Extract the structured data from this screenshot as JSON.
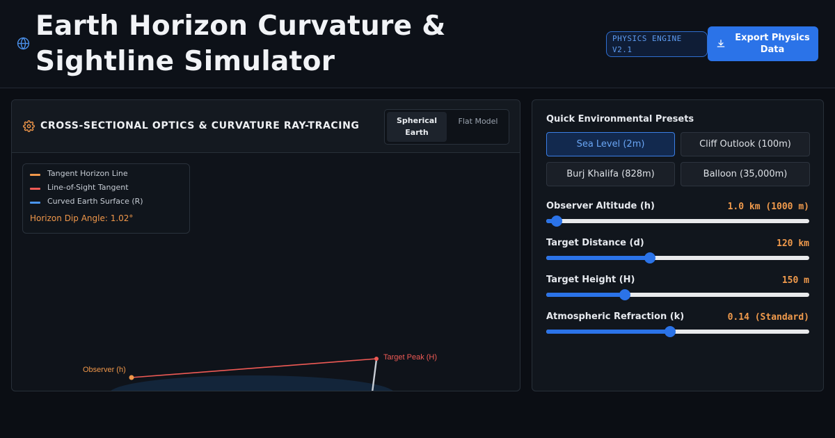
{
  "header": {
    "title": "Earth Horizon Curvature & Sightline Simulator",
    "badge": "PHYSICS ENGINE V2.1",
    "export_label": "Export Physics Data"
  },
  "viz": {
    "title": "CROSS-SECTIONAL OPTICS & CURVATURE RAY-TRACING",
    "model_options": [
      "Spherical Earth",
      "Flat Model"
    ],
    "selected_model": "Spherical Earth",
    "legend": [
      {
        "label": "Tangent Horizon Line",
        "color": "#f0974a"
      },
      {
        "label": "Line-of-Sight Tangent",
        "color": "#ef5a55"
      },
      {
        "label": "Curved Earth Surface (R)",
        "color": "#4a95f0"
      }
    ],
    "dip_label": "Horizon Dip Angle: 1.02°",
    "observer_label": "Observer (h)",
    "target_label": "Target Peak (H)"
  },
  "controls": {
    "presets_title": "Quick Environmental Presets",
    "presets": [
      "Sea Level (2m)",
      "Cliff Outlook (100m)",
      "Burj Khalifa (828m)",
      "Balloon (35,000m)"
    ],
    "active_preset": "Sea Level (2m)",
    "sliders": [
      {
        "label": "Observer Altitude (h)",
        "value_text": "1.0 km (1000 m)",
        "level": 0.04
      },
      {
        "label": "Target Distance (d)",
        "value_text": "120 km",
        "level": 0.395
      },
      {
        "label": "Target Height (H)",
        "value_text": "150 m",
        "level": 0.3
      },
      {
        "label": "Atmospheric Refraction (k)",
        "value_text": "0.14 (Standard)",
        "level": 0.47
      }
    ]
  },
  "colors": {
    "accent": "#2b73e8",
    "value_orange": "#f09a4c",
    "sightline_red": "#ef5a55"
  }
}
